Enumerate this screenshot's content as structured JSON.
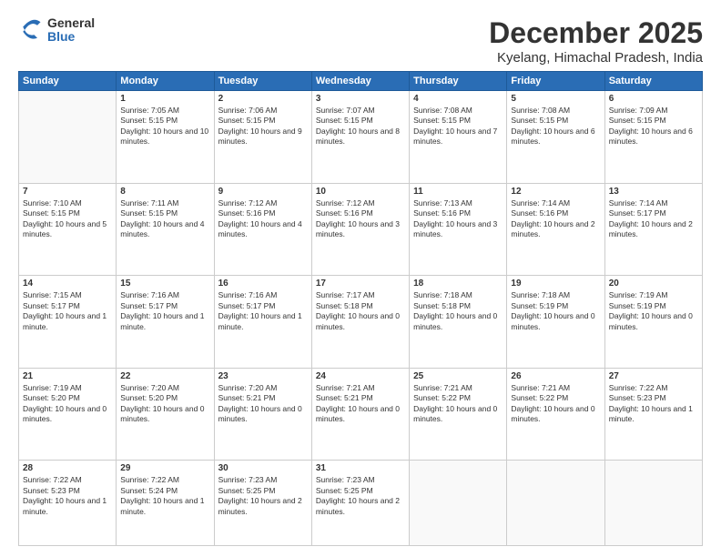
{
  "logo": {
    "general": "General",
    "blue": "Blue"
  },
  "header": {
    "month": "December 2025",
    "location": "Kyelang, Himachal Pradesh, India"
  },
  "weekdays": [
    "Sunday",
    "Monday",
    "Tuesday",
    "Wednesday",
    "Thursday",
    "Friday",
    "Saturday"
  ],
  "weeks": [
    [
      {
        "day": "",
        "empty": true
      },
      {
        "day": "1",
        "sunrise": "7:05 AM",
        "sunset": "5:15 PM",
        "daylight": "10 hours and 10 minutes."
      },
      {
        "day": "2",
        "sunrise": "7:06 AM",
        "sunset": "5:15 PM",
        "daylight": "10 hours and 9 minutes."
      },
      {
        "day": "3",
        "sunrise": "7:07 AM",
        "sunset": "5:15 PM",
        "daylight": "10 hours and 8 minutes."
      },
      {
        "day": "4",
        "sunrise": "7:08 AM",
        "sunset": "5:15 PM",
        "daylight": "10 hours and 7 minutes."
      },
      {
        "day": "5",
        "sunrise": "7:08 AM",
        "sunset": "5:15 PM",
        "daylight": "10 hours and 6 minutes."
      },
      {
        "day": "6",
        "sunrise": "7:09 AM",
        "sunset": "5:15 PM",
        "daylight": "10 hours and 6 minutes."
      }
    ],
    [
      {
        "day": "7",
        "sunrise": "7:10 AM",
        "sunset": "5:15 PM",
        "daylight": "10 hours and 5 minutes."
      },
      {
        "day": "8",
        "sunrise": "7:11 AM",
        "sunset": "5:15 PM",
        "daylight": "10 hours and 4 minutes."
      },
      {
        "day": "9",
        "sunrise": "7:12 AM",
        "sunset": "5:16 PM",
        "daylight": "10 hours and 4 minutes."
      },
      {
        "day": "10",
        "sunrise": "7:12 AM",
        "sunset": "5:16 PM",
        "daylight": "10 hours and 3 minutes."
      },
      {
        "day": "11",
        "sunrise": "7:13 AM",
        "sunset": "5:16 PM",
        "daylight": "10 hours and 3 minutes."
      },
      {
        "day": "12",
        "sunrise": "7:14 AM",
        "sunset": "5:16 PM",
        "daylight": "10 hours and 2 minutes."
      },
      {
        "day": "13",
        "sunrise": "7:14 AM",
        "sunset": "5:17 PM",
        "daylight": "10 hours and 2 minutes."
      }
    ],
    [
      {
        "day": "14",
        "sunrise": "7:15 AM",
        "sunset": "5:17 PM",
        "daylight": "10 hours and 1 minute."
      },
      {
        "day": "15",
        "sunrise": "7:16 AM",
        "sunset": "5:17 PM",
        "daylight": "10 hours and 1 minute."
      },
      {
        "day": "16",
        "sunrise": "7:16 AM",
        "sunset": "5:17 PM",
        "daylight": "10 hours and 1 minute."
      },
      {
        "day": "17",
        "sunrise": "7:17 AM",
        "sunset": "5:18 PM",
        "daylight": "10 hours and 0 minutes."
      },
      {
        "day": "18",
        "sunrise": "7:18 AM",
        "sunset": "5:18 PM",
        "daylight": "10 hours and 0 minutes."
      },
      {
        "day": "19",
        "sunrise": "7:18 AM",
        "sunset": "5:19 PM",
        "daylight": "10 hours and 0 minutes."
      },
      {
        "day": "20",
        "sunrise": "7:19 AM",
        "sunset": "5:19 PM",
        "daylight": "10 hours and 0 minutes."
      }
    ],
    [
      {
        "day": "21",
        "sunrise": "7:19 AM",
        "sunset": "5:20 PM",
        "daylight": "10 hours and 0 minutes."
      },
      {
        "day": "22",
        "sunrise": "7:20 AM",
        "sunset": "5:20 PM",
        "daylight": "10 hours and 0 minutes."
      },
      {
        "day": "23",
        "sunrise": "7:20 AM",
        "sunset": "5:21 PM",
        "daylight": "10 hours and 0 minutes."
      },
      {
        "day": "24",
        "sunrise": "7:21 AM",
        "sunset": "5:21 PM",
        "daylight": "10 hours and 0 minutes."
      },
      {
        "day": "25",
        "sunrise": "7:21 AM",
        "sunset": "5:22 PM",
        "daylight": "10 hours and 0 minutes."
      },
      {
        "day": "26",
        "sunrise": "7:21 AM",
        "sunset": "5:22 PM",
        "daylight": "10 hours and 0 minutes."
      },
      {
        "day": "27",
        "sunrise": "7:22 AM",
        "sunset": "5:23 PM",
        "daylight": "10 hours and 1 minute."
      }
    ],
    [
      {
        "day": "28",
        "sunrise": "7:22 AM",
        "sunset": "5:23 PM",
        "daylight": "10 hours and 1 minute."
      },
      {
        "day": "29",
        "sunrise": "7:22 AM",
        "sunset": "5:24 PM",
        "daylight": "10 hours and 1 minute."
      },
      {
        "day": "30",
        "sunrise": "7:23 AM",
        "sunset": "5:25 PM",
        "daylight": "10 hours and 2 minutes."
      },
      {
        "day": "31",
        "sunrise": "7:23 AM",
        "sunset": "5:25 PM",
        "daylight": "10 hours and 2 minutes."
      },
      {
        "day": "",
        "empty": true
      },
      {
        "day": "",
        "empty": true
      },
      {
        "day": "",
        "empty": true
      }
    ]
  ]
}
